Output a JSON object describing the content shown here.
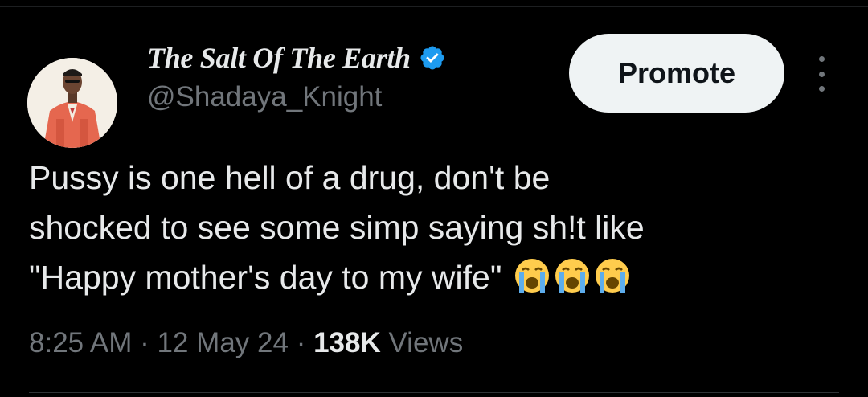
{
  "tweet_header": {
    "display_name": "The Salt Of The Earth",
    "handle": "@Shadaya_Knight",
    "verified_icon": "verified-badge-icon",
    "promote_label": "Promote",
    "more_icon": "more-vertical-icon"
  },
  "tweet_body": {
    "line1": "Pussy is one hell of a drug, don't be",
    "line2": "shocked to see some simp saying sh!t like",
    "line3": "\"Happy mother's day to my wife\"",
    "emojis": [
      "😭",
      "😭",
      "😭"
    ]
  },
  "tweet_meta": {
    "time": "8:25 AM",
    "sep1": " · ",
    "date": "12 May 24",
    "sep2": " · ",
    "views_count": "138K",
    "views_label": " Views"
  },
  "colors": {
    "background": "#000000",
    "text_primary": "#e7e9ea",
    "text_secondary": "#71767b",
    "verified_blue": "#1d9bf0",
    "button_bg": "#eff3f4"
  }
}
